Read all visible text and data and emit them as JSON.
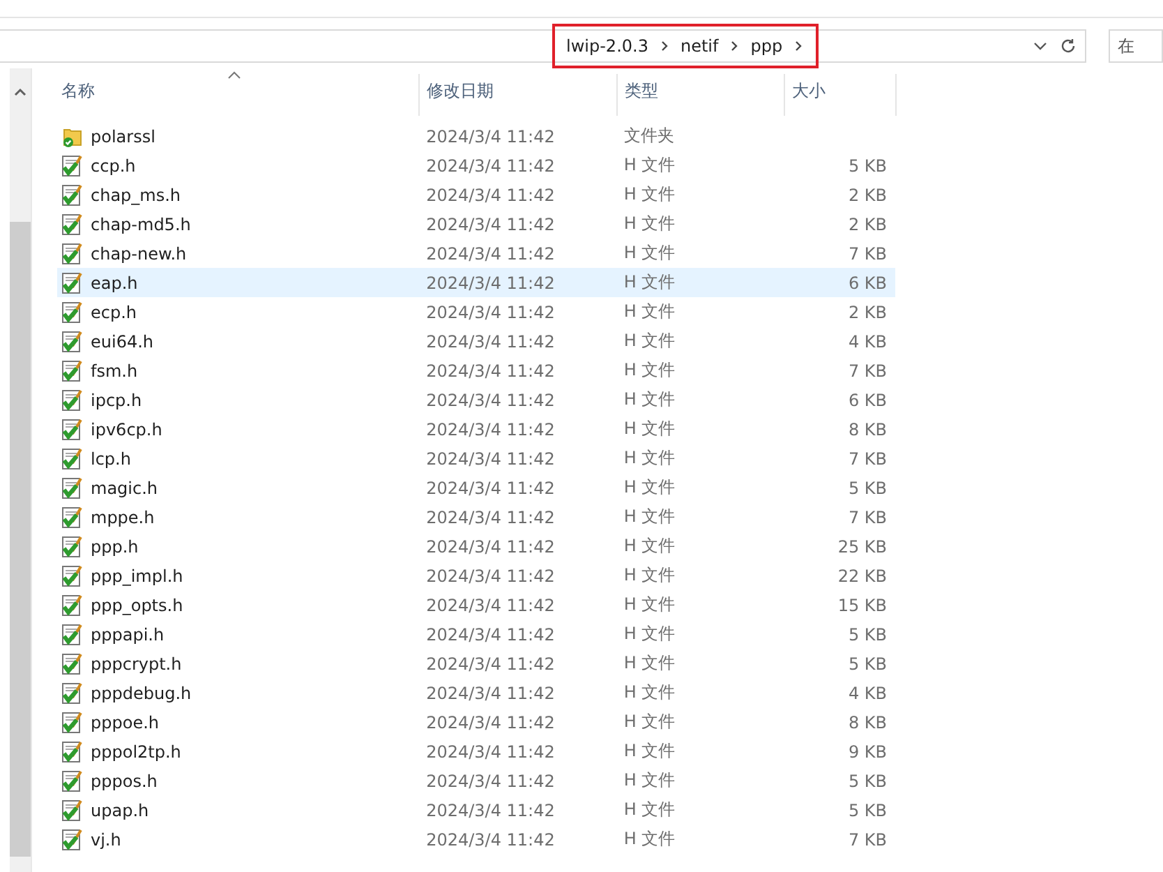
{
  "address_bar": {
    "crumbs": [
      "lwip-2.0.3",
      "netif",
      "ppp"
    ],
    "highlighted": true
  },
  "search": {
    "placeholder": "在"
  },
  "table": {
    "columns": [
      "名称",
      "修改日期",
      "类型",
      "大小"
    ],
    "rows": [
      {
        "kind": "folder",
        "name": "polarssl",
        "date": "2024/3/4 11:42",
        "type": "文件夹",
        "size": "",
        "selected": false
      },
      {
        "kind": "file",
        "name": "ccp.h",
        "date": "2024/3/4 11:42",
        "type": "H 文件",
        "size": "5 KB",
        "selected": false
      },
      {
        "kind": "file",
        "name": "chap_ms.h",
        "date": "2024/3/4 11:42",
        "type": "H 文件",
        "size": "2 KB",
        "selected": false
      },
      {
        "kind": "file",
        "name": "chap-md5.h",
        "date": "2024/3/4 11:42",
        "type": "H 文件",
        "size": "2 KB",
        "selected": false
      },
      {
        "kind": "file",
        "name": "chap-new.h",
        "date": "2024/3/4 11:42",
        "type": "H 文件",
        "size": "7 KB",
        "selected": false
      },
      {
        "kind": "file",
        "name": "eap.h",
        "date": "2024/3/4 11:42",
        "type": "H 文件",
        "size": "6 KB",
        "selected": true
      },
      {
        "kind": "file",
        "name": "ecp.h",
        "date": "2024/3/4 11:42",
        "type": "H 文件",
        "size": "2 KB",
        "selected": false
      },
      {
        "kind": "file",
        "name": "eui64.h",
        "date": "2024/3/4 11:42",
        "type": "H 文件",
        "size": "4 KB",
        "selected": false
      },
      {
        "kind": "file",
        "name": "fsm.h",
        "date": "2024/3/4 11:42",
        "type": "H 文件",
        "size": "7 KB",
        "selected": false
      },
      {
        "kind": "file",
        "name": "ipcp.h",
        "date": "2024/3/4 11:42",
        "type": "H 文件",
        "size": "6 KB",
        "selected": false
      },
      {
        "kind": "file",
        "name": "ipv6cp.h",
        "date": "2024/3/4 11:42",
        "type": "H 文件",
        "size": "8 KB",
        "selected": false
      },
      {
        "kind": "file",
        "name": "lcp.h",
        "date": "2024/3/4 11:42",
        "type": "H 文件",
        "size": "7 KB",
        "selected": false
      },
      {
        "kind": "file",
        "name": "magic.h",
        "date": "2024/3/4 11:42",
        "type": "H 文件",
        "size": "5 KB",
        "selected": false
      },
      {
        "kind": "file",
        "name": "mppe.h",
        "date": "2024/3/4 11:42",
        "type": "H 文件",
        "size": "7 KB",
        "selected": false
      },
      {
        "kind": "file",
        "name": "ppp.h",
        "date": "2024/3/4 11:42",
        "type": "H 文件",
        "size": "25 KB",
        "selected": false
      },
      {
        "kind": "file",
        "name": "ppp_impl.h",
        "date": "2024/3/4 11:42",
        "type": "H 文件",
        "size": "22 KB",
        "selected": false
      },
      {
        "kind": "file",
        "name": "ppp_opts.h",
        "date": "2024/3/4 11:42",
        "type": "H 文件",
        "size": "15 KB",
        "selected": false
      },
      {
        "kind": "file",
        "name": "pppapi.h",
        "date": "2024/3/4 11:42",
        "type": "H 文件",
        "size": "5 KB",
        "selected": false
      },
      {
        "kind": "file",
        "name": "pppcrypt.h",
        "date": "2024/3/4 11:42",
        "type": "H 文件",
        "size": "5 KB",
        "selected": false
      },
      {
        "kind": "file",
        "name": "pppdebug.h",
        "date": "2024/3/4 11:42",
        "type": "H 文件",
        "size": "4 KB",
        "selected": false
      },
      {
        "kind": "file",
        "name": "pppoe.h",
        "date": "2024/3/4 11:42",
        "type": "H 文件",
        "size": "8 KB",
        "selected": false
      },
      {
        "kind": "file",
        "name": "pppol2tp.h",
        "date": "2024/3/4 11:42",
        "type": "H 文件",
        "size": "9 KB",
        "selected": false
      },
      {
        "kind": "file",
        "name": "pppos.h",
        "date": "2024/3/4 11:42",
        "type": "H 文件",
        "size": "5 KB",
        "selected": false
      },
      {
        "kind": "file",
        "name": "upap.h",
        "date": "2024/3/4 11:42",
        "type": "H 文件",
        "size": "5 KB",
        "selected": false
      },
      {
        "kind": "file",
        "name": "vj.h",
        "date": "2024/3/4 11:42",
        "type": "H 文件",
        "size": "7 KB",
        "selected": false
      }
    ]
  }
}
